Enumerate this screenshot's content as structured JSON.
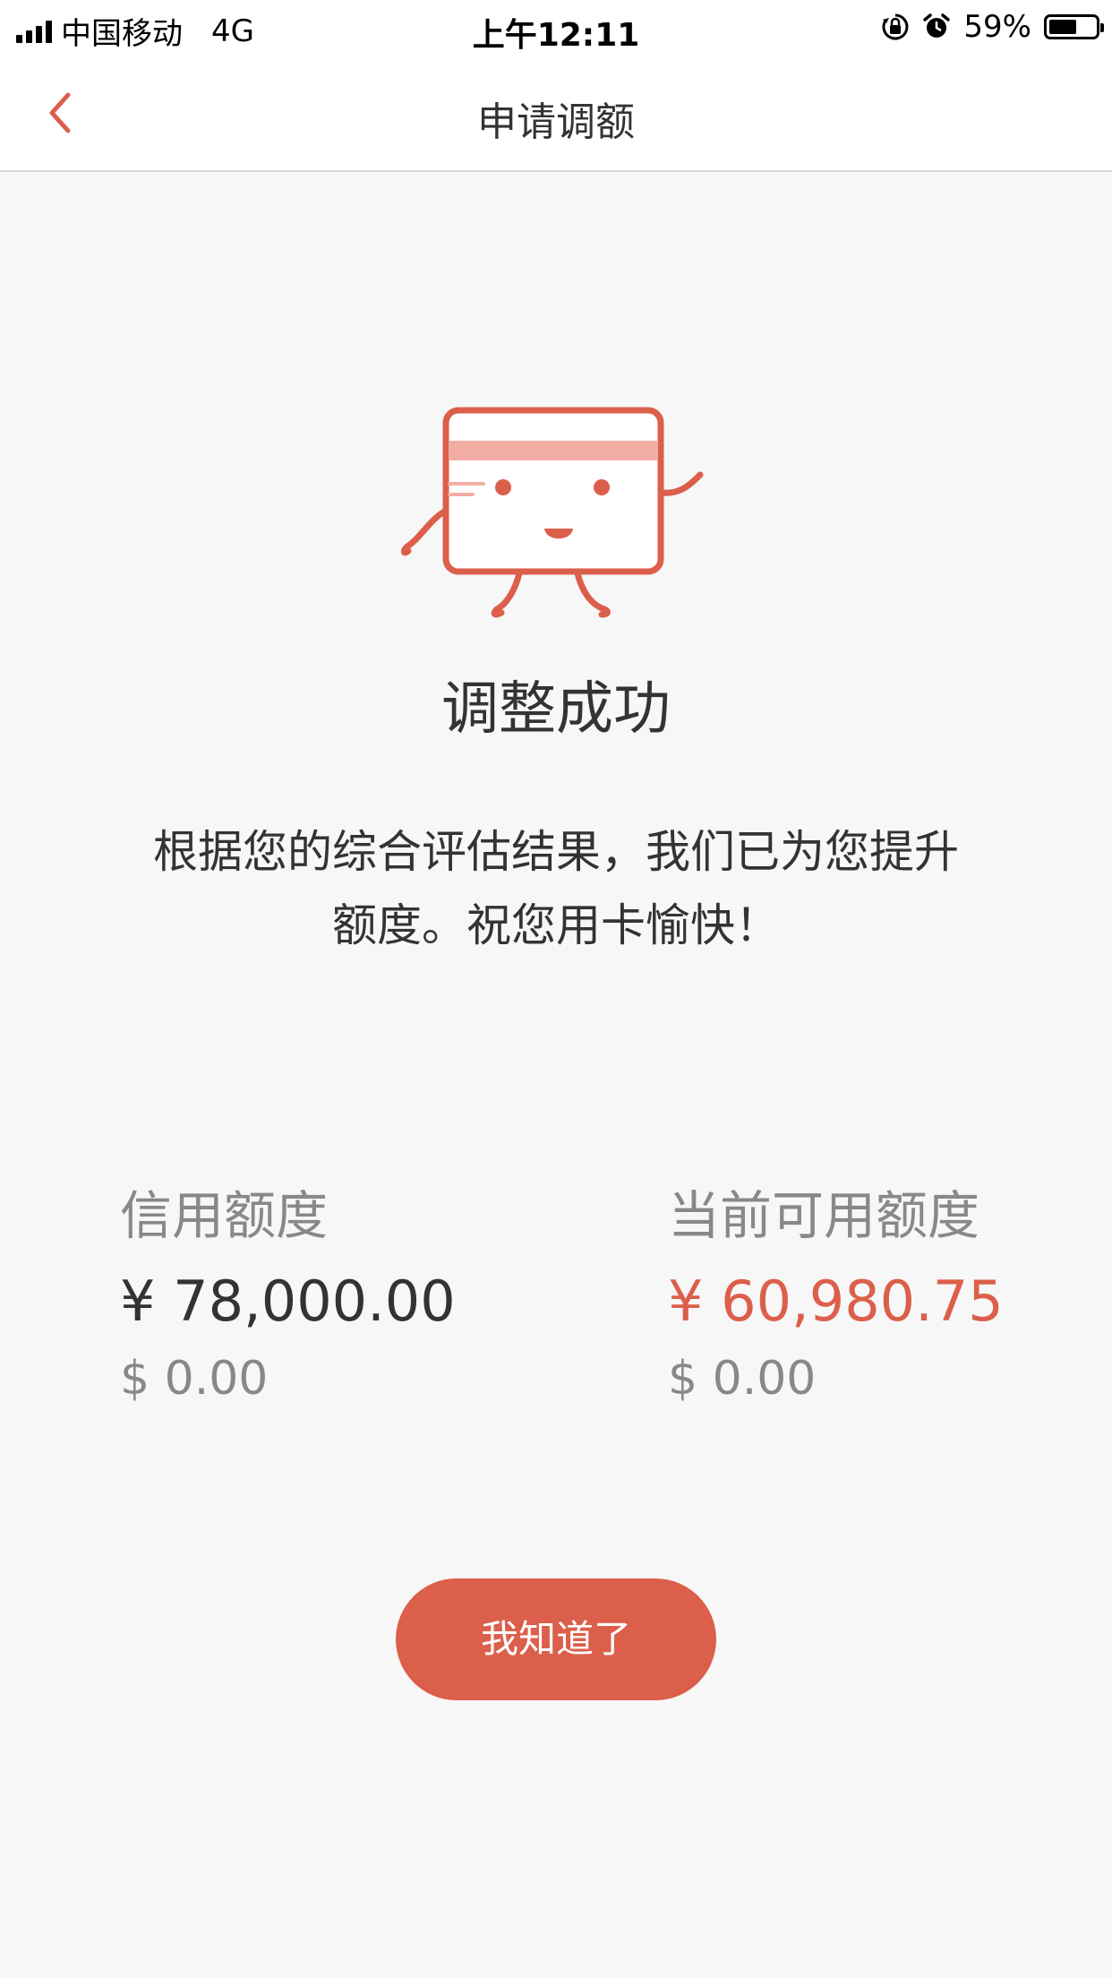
{
  "status_bar": {
    "carrier": "中国移动",
    "network": "4G",
    "time": "上午12:11",
    "battery_percent": "59%",
    "battery_level": 0.59,
    "icons": [
      "signal-icon",
      "orientation-lock-icon",
      "alarm-icon",
      "battery-icon"
    ]
  },
  "nav": {
    "title": "申请调额",
    "back_icon": "chevron-left-icon"
  },
  "result": {
    "title": "调整成功",
    "description": "根据您的综合评估结果，我们已为您提升额度。祝您用卡愉快！"
  },
  "limits": {
    "credit": {
      "label": "信用额度",
      "cny": "¥ 78,000.00",
      "usd": "$ 0.00"
    },
    "available": {
      "label": "当前可用额度",
      "cny": "¥ 60,980.75",
      "usd": "$ 0.00"
    }
  },
  "button": {
    "confirm_label": "我知道了"
  },
  "colors": {
    "accent": "#dc5f4b",
    "accent_light": "#f2aea5",
    "background": "#f7f7f7",
    "text_primary": "#333333",
    "text_secondary": "#888888"
  }
}
